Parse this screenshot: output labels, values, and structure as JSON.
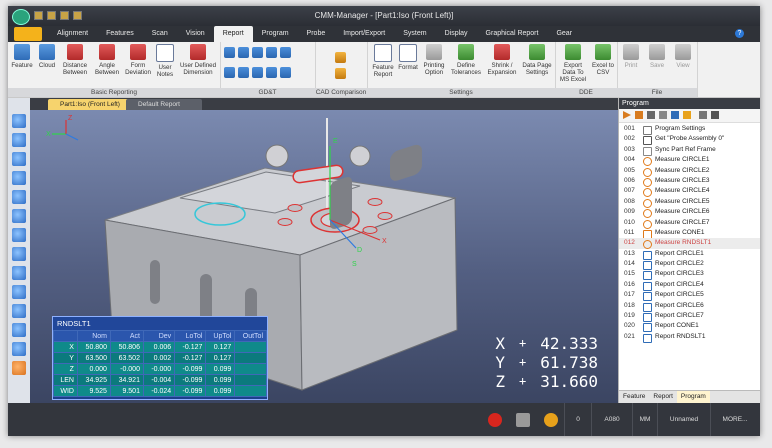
{
  "window": {
    "title": "CMM-Manager - [Part1:Iso (Front Left)]"
  },
  "menu": {
    "tabs": [
      "Alignment",
      "Features",
      "Scan",
      "Vision",
      "Report",
      "Program",
      "Probe",
      "Import/Export",
      "System",
      "Display",
      "Graphical Report",
      "Gear"
    ],
    "active_index": 4
  },
  "ribbon": {
    "groups": [
      {
        "label": "Basic Reporting",
        "buttons": [
          "Feature",
          "Cloud",
          "Distance Between",
          "Angle Between",
          "Form Deviation",
          "User Notes",
          "User Defined Dimension"
        ]
      },
      {
        "label": "GD&T",
        "buttons": []
      },
      {
        "label": "CAD Comparison",
        "buttons": []
      },
      {
        "label": "Settings",
        "buttons": [
          "Feature Report",
          "Format",
          "Printing Option",
          "Define Tolerances",
          "Shrink / Expansion",
          "Data Page Settings"
        ]
      },
      {
        "label": "DDE",
        "buttons": [
          "Export Data To MS Excel",
          "Excel to CSV"
        ]
      },
      {
        "label": "File",
        "buttons": [
          "Print",
          "Save",
          "View"
        ]
      }
    ]
  },
  "doc_tabs": [
    {
      "label": "Part1:Iso (Front Left)",
      "active": true
    },
    {
      "label": "Default Report",
      "active": false
    }
  ],
  "axes_label": {
    "x": "X",
    "y": "Y",
    "z": "Z",
    "e": "E",
    "d": "D",
    "s": "S"
  },
  "stats": {
    "title": "RNDSLT1",
    "headers": [
      "",
      "Nom",
      "Act",
      "Dev",
      "LoTol",
      "UpTol",
      "OutTol"
    ],
    "rows": [
      [
        "X",
        "50.800",
        "50.806",
        "0.006",
        "-0.127",
        "0.127",
        ""
      ],
      [
        "Y",
        "63.500",
        "63.502",
        "0.002",
        "-0.127",
        "0.127",
        ""
      ],
      [
        "Z",
        "0.000",
        "-0.000",
        "-0.000",
        "-0.099",
        "0.099",
        ""
      ],
      [
        "LEN",
        "34.925",
        "34.921",
        "-0.004",
        "-0.099",
        "0.099",
        ""
      ],
      [
        "WID",
        "9.525",
        "9.501",
        "-0.024",
        "-0.099",
        "0.099",
        ""
      ]
    ]
  },
  "readout": {
    "x_label": "X",
    "y_label": "Y",
    "z_label": "Z",
    "x": "42.333",
    "y": "61.738",
    "z": "31.660",
    "sign": "+"
  },
  "program": {
    "title": "Program",
    "items": [
      {
        "num": "001",
        "label": "Program Settings",
        "icon": "settings-icon"
      },
      {
        "num": "002",
        "label": "Get \"Probe Assembly 0\"",
        "icon": "probe-icon"
      },
      {
        "num": "003",
        "label": "Sync Part Ref Frame",
        "icon": "sync-icon"
      },
      {
        "num": "004",
        "label": "Measure CIRCLE1",
        "icon": "circle-icon"
      },
      {
        "num": "005",
        "label": "Measure CIRCLE2",
        "icon": "circle-icon"
      },
      {
        "num": "006",
        "label": "Measure CIRCLE3",
        "icon": "circle-icon"
      },
      {
        "num": "007",
        "label": "Measure CIRCLE4",
        "icon": "circle-icon"
      },
      {
        "num": "008",
        "label": "Measure CIRCLE5",
        "icon": "circle-icon"
      },
      {
        "num": "009",
        "label": "Measure CIRCLE6",
        "icon": "circle-icon"
      },
      {
        "num": "010",
        "label": "Measure CIRCLE7",
        "icon": "circle-icon"
      },
      {
        "num": "011",
        "label": "Measure CONE1",
        "icon": "cone-icon"
      },
      {
        "num": "012",
        "label": "Measure RNDSLT1",
        "icon": "slot-icon"
      },
      {
        "num": "013",
        "label": "Report CIRCLE1",
        "icon": "report-icon"
      },
      {
        "num": "014",
        "label": "Report CIRCLE2",
        "icon": "report-icon"
      },
      {
        "num": "015",
        "label": "Report CIRCLE3",
        "icon": "report-icon"
      },
      {
        "num": "016",
        "label": "Report CIRCLE4",
        "icon": "report-icon"
      },
      {
        "num": "017",
        "label": "Report CIRCLE5",
        "icon": "report-icon"
      },
      {
        "num": "018",
        "label": "Report CIRCLE6",
        "icon": "report-icon"
      },
      {
        "num": "019",
        "label": "Report CIRCLE7",
        "icon": "report-icon"
      },
      {
        "num": "020",
        "label": "Report CONE1",
        "icon": "report-icon"
      },
      {
        "num": "021",
        "label": "Report RNDSLT1",
        "icon": "report-icon"
      }
    ],
    "selected_index": 11,
    "bottom_tabs": [
      "Feature",
      "Report",
      "Program"
    ],
    "active_bottom_tab": 2
  },
  "status": {
    "coord": "0",
    "temp": "A080",
    "units": "MM",
    "name": "Unnamed",
    "more": "MORE..."
  }
}
